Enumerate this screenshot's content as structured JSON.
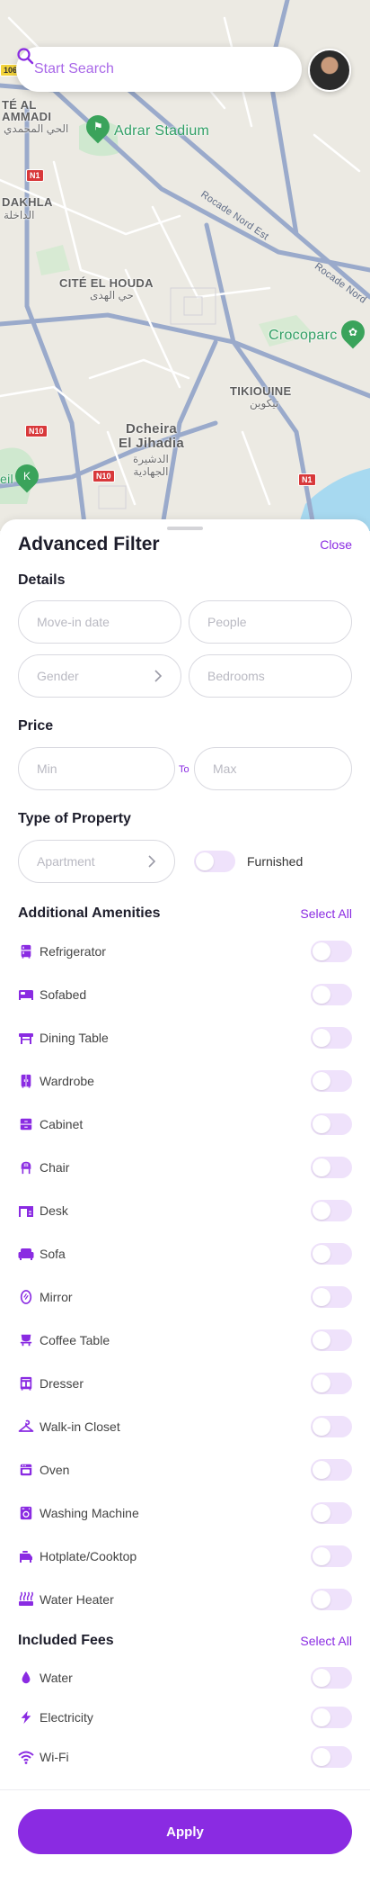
{
  "map": {
    "labels": {
      "te_al_ammadi": "TÉ AL\nAMMADI",
      "te_al_ammadi_ar": "الحي المحمدي",
      "adrar_stadium": "Adrar Stadium",
      "dakhla": "DAKHLA",
      "dakhla_ar": "الداخلة",
      "cite_el_houda": "CITÉ EL HOUDA",
      "cite_el_houda_ar": "حي الهدى",
      "crocoparc": "Crocoparc",
      "tikiouine": "TIKIOUINE",
      "tikiouine_ar": "تيكوين",
      "dcheira": "Dcheira\nEl Jihadia",
      "dcheira_ar": "الدشيرة\nالجهادية",
      "rocade_1": "Rocade Nord Est",
      "rocade_2": "Rocade Nord",
      "eil": "eil"
    },
    "shields": {
      "n1_a": "N1",
      "n1_b": "N1",
      "n10_a": "N10",
      "n10_b": "N10",
      "r106": "106"
    }
  },
  "search": {
    "placeholder": "Start Search"
  },
  "sheet": {
    "title": "Advanced Filter",
    "close_label": "Close",
    "details": {
      "title": "Details",
      "move_in_placeholder": "Move-in date",
      "people_placeholder": "People",
      "gender_placeholder": "Gender",
      "bedrooms_placeholder": "Bedrooms"
    },
    "price": {
      "title": "Price",
      "min_placeholder": "Min",
      "to_label": "To",
      "max_placeholder": "Max"
    },
    "property": {
      "title": "Type of Property",
      "type_placeholder": "Apartment",
      "furnished_label": "Furnished",
      "furnished_on": false
    },
    "amenities": {
      "title": "Additional Amenities",
      "select_all": "Select All",
      "items": [
        {
          "label": "Refrigerator",
          "icon": "refrigerator-icon",
          "on": false
        },
        {
          "label": "Sofabed",
          "icon": "sofabed-icon",
          "on": false
        },
        {
          "label": "Dining Table",
          "icon": "dining-table-icon",
          "on": false
        },
        {
          "label": "Wardrobe",
          "icon": "wardrobe-icon",
          "on": false
        },
        {
          "label": "Cabinet",
          "icon": "cabinet-icon",
          "on": false
        },
        {
          "label": "Chair",
          "icon": "chair-icon",
          "on": false
        },
        {
          "label": "Desk",
          "icon": "desk-icon",
          "on": false
        },
        {
          "label": "Sofa",
          "icon": "sofa-icon",
          "on": false
        },
        {
          "label": "Mirror",
          "icon": "mirror-icon",
          "on": false
        },
        {
          "label": "Coffee Table",
          "icon": "coffee-table-icon",
          "on": false
        },
        {
          "label": "Dresser",
          "icon": "dresser-icon",
          "on": false
        },
        {
          "label": "Walk-in Closet",
          "icon": "hanger-icon",
          "on": false
        },
        {
          "label": "Oven",
          "icon": "oven-icon",
          "on": false
        },
        {
          "label": "Washing Machine",
          "icon": "washing-machine-icon",
          "on": false
        },
        {
          "label": "Hotplate/Cooktop",
          "icon": "hotplate-icon",
          "on": false
        },
        {
          "label": "Water Heater",
          "icon": "water-heater-icon",
          "on": false
        }
      ]
    },
    "fees": {
      "title": "Included Fees",
      "select_all": "Select All",
      "items": [
        {
          "label": "Water",
          "icon": "water-drop-icon",
          "on": false
        },
        {
          "label": "Electricity",
          "icon": "lightning-icon",
          "on": false
        },
        {
          "label": "Wi-Fi",
          "icon": "wifi-icon",
          "on": false
        }
      ]
    },
    "apply_label": "Apply"
  },
  "colors": {
    "accent": "#8a2be2",
    "toggle_off": "#efe2fb"
  }
}
